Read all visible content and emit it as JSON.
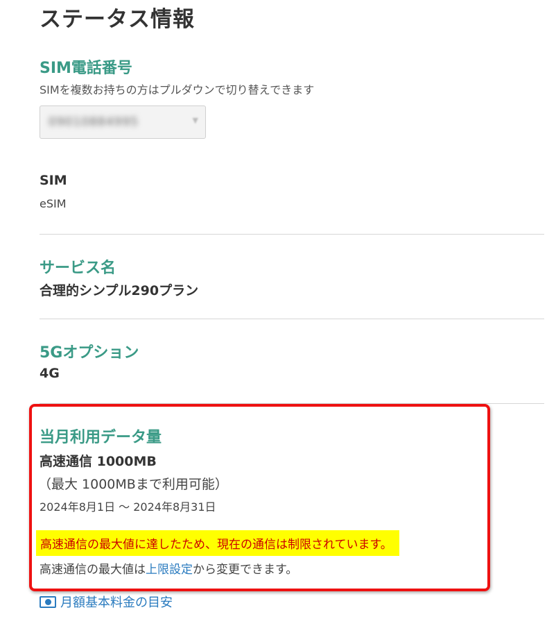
{
  "page": {
    "title": "ステータス情報"
  },
  "sim_phone": {
    "heading": "SIM電話番号",
    "description": "SIMを複数お持ちの方はプルダウンで切り替えできます",
    "selected_number": "09010884995"
  },
  "sim": {
    "heading": "SIM",
    "value": "eSIM"
  },
  "service": {
    "heading": "サービス名",
    "value": "合理的シンプル290プラン"
  },
  "option_5g": {
    "heading": "5Gオプション",
    "value": "4G"
  },
  "data_usage": {
    "heading": "当月利用データ量",
    "high_speed": "高速通信 1000MB",
    "max_note": "（最大 1000MBまで利用可能）",
    "period": "2024年8月1日 ～ 2024年8月31日",
    "warning": "高速通信の最大値に達したため、現在の通信は制限されています。",
    "limit_prefix": "高速通信の最大値は",
    "limit_link": "上限設定",
    "limit_suffix": "から変更できます。"
  },
  "footer": {
    "fee_link": "月額基本料金の目安"
  },
  "colors": {
    "accent_green": "#3a9a86",
    "link_blue": "#2a7bbf",
    "warning_red": "#cc0000",
    "warning_highlight": "#ffff00",
    "annotation_red": "#ee1111"
  }
}
